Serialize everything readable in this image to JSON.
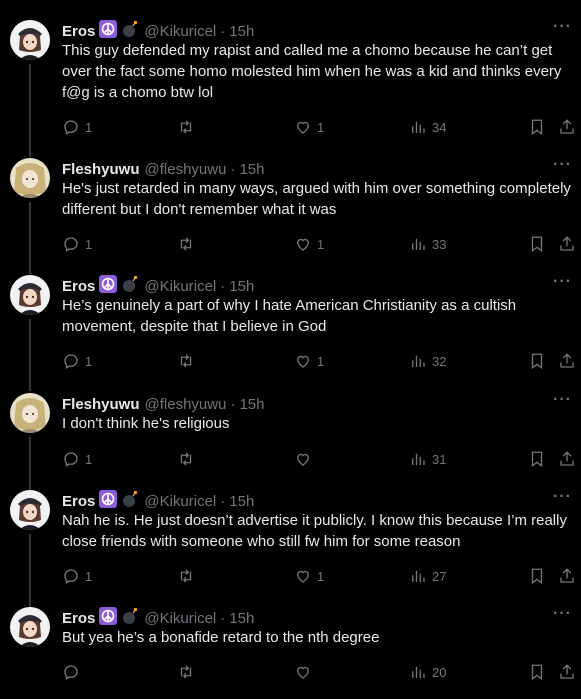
{
  "tweets": [
    {
      "display_name": "Eros",
      "badges": [
        "☮",
        "💣"
      ],
      "handle": "@Kikuricel",
      "separator": "·",
      "time": "15h",
      "text": "This guy defended my rapist and called me a chomo because he can’t get over the fact some homo molested him when he was a kid and thinks every f@g is a chomo btw lol",
      "replies": "1",
      "retweets": "",
      "likes": "1",
      "views": "34",
      "avatar": "eros"
    },
    {
      "display_name": "Fleshyuwu",
      "badges": [],
      "handle": "@fleshyuwu",
      "separator": "·",
      "time": "15h",
      "text": "He's just retarded in many ways, argued with him over something completely different but I don't remember what it was",
      "replies": "1",
      "retweets": "",
      "likes": "1",
      "views": "33",
      "avatar": "fleshy"
    },
    {
      "display_name": "Eros",
      "badges": [
        "☮",
        "💣"
      ],
      "handle": "@Kikuricel",
      "separator": "·",
      "time": "15h",
      "text": "He’s genuinely a part of why I hate American Christianity as a cultish movement, despite that I believe in God",
      "replies": "1",
      "retweets": "",
      "likes": "1",
      "views": "32",
      "avatar": "eros"
    },
    {
      "display_name": "Fleshyuwu",
      "badges": [],
      "handle": "@fleshyuwu",
      "separator": "·",
      "time": "15h",
      "text": "I don't think he's religious",
      "replies": "1",
      "retweets": "",
      "likes": "",
      "views": "31",
      "avatar": "fleshy"
    },
    {
      "display_name": "Eros",
      "badges": [
        "☮",
        "💣"
      ],
      "handle": "@Kikuricel",
      "separator": "·",
      "time": "15h",
      "text": "Nah he is. He just doesn’t advertise it publicly. I know this because I’m really close friends with someone who still fw him for some reason",
      "replies": "1",
      "retweets": "",
      "likes": "1",
      "views": "27",
      "avatar": "eros"
    },
    {
      "display_name": "Eros",
      "badges": [
        "☮",
        "💣"
      ],
      "handle": "@Kikuricel",
      "separator": "·",
      "time": "15h",
      "text": "But yea he’s a bonafide retard to the nth degree",
      "replies": "",
      "retweets": "",
      "likes": "",
      "views": "20",
      "avatar": "eros"
    }
  ],
  "more_label": "···",
  "colors": {
    "background": "#000000",
    "text": "#e7e9ea",
    "muted": "#71767b",
    "thread_line": "#333639",
    "peace_badge": "#8e5bd8"
  }
}
